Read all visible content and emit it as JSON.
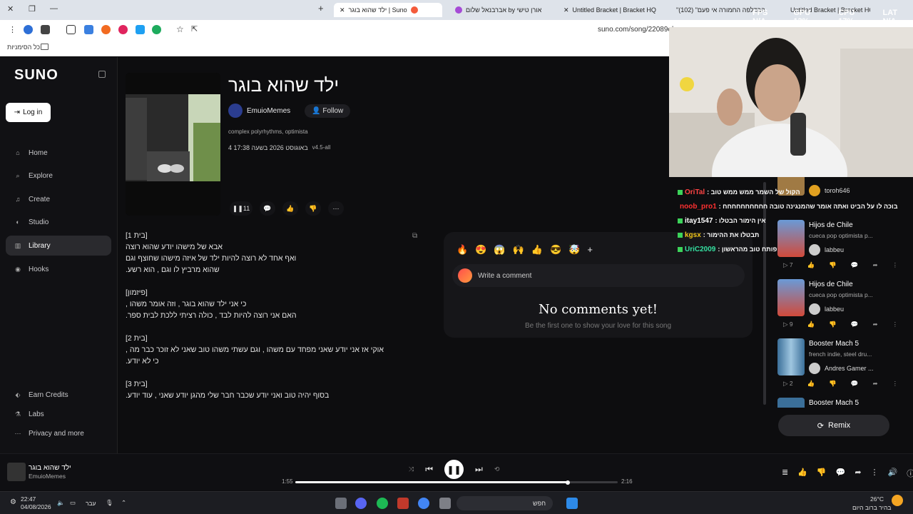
{
  "browser": {
    "tabs": [
      {
        "label": "ילד שהוא בוגר | Suno",
        "active": true,
        "color": "#f45b3b"
      },
      {
        "label": "אברבנאל שלום by אורן טישי",
        "active": false,
        "color": "#a64bd6"
      },
      {
        "label": "Untitled Bracket | Bracket HQ",
        "active": false,
        "color": "#2f55d4"
      },
      {
        "label": "\"ההדלפה החמורה אי פעם\" (102)",
        "active": false,
        "color": "#e0253a"
      },
      {
        "label": "Untitled Bracket | Bracket HQ",
        "active": false,
        "color": "#2f55d4"
      }
    ],
    "url": "suno.com/song/22089el",
    "bookmarks_label": "כל הסימניות"
  },
  "hud": {
    "fps": "FPS N/A",
    "gpu": "GPU 13%",
    "cpu": "CPU 17%",
    "lat": "LAT N/A"
  },
  "sidebar": {
    "logo": "SUNO",
    "login": "Log in",
    "nav": [
      {
        "label": "Home",
        "icon": "home-icon"
      },
      {
        "label": "Explore",
        "icon": "search-icon"
      },
      {
        "label": "Create",
        "icon": "music-icon"
      },
      {
        "label": "Studio",
        "icon": "studio-icon"
      },
      {
        "label": "Library",
        "icon": "library-icon",
        "active": true
      },
      {
        "label": "Hooks",
        "icon": "hooks-icon"
      }
    ],
    "bottom": [
      {
        "label": "Earn Credits",
        "icon": "credits-icon"
      },
      {
        "label": "Labs",
        "icon": "labs-icon"
      },
      {
        "label": "Privacy and more",
        "icon": "more-icon"
      }
    ]
  },
  "song": {
    "title": "ילד שהוא בוגר",
    "artist": "EmuioMemes",
    "follow": "Follow",
    "tags": "complex polyrhythms, optimista",
    "date": "4 באוגוסט 2026 בשעה 17:38",
    "version": "v4.5-all",
    "plays": "11"
  },
  "lyrics": [
    [
      "[בית 1]",
      "אבא של מישהו יודע שהוא רוצה",
      "ואף אחד לא רוצה להיות ילד של איזה מישהו שחוצף וגם",
      "שהוא מרביץ לו וגם , הוא רשע."
    ],
    [
      "[פיזמון]",
      "כי אני ילד שהוא בוגר , וזה אומר משהו ,",
      "האם אני רוצה להיות לבד , כולה רציתי ללכת לבית ספר."
    ],
    [
      "[בית 2]",
      "אוקי אז אני יודע שאני מפחד עם משהו , וגם עשתי משהו טוב שאני לא זוכר כבר מה ,",
      "כי לא יודע."
    ],
    [
      "[בית 3]",
      "בסוף יהיה טוב ואני יודע שכבר חבר שלי מהגן יודע שאני , עוד יודע."
    ]
  ],
  "comments": {
    "emojis": [
      "🔥",
      "😍",
      "😱",
      "🙌",
      "👍",
      "😎",
      "🤯",
      "+"
    ],
    "placeholder": "Write a comment",
    "empty_title": "No comments yet!",
    "empty_sub": "Be the first one to show your love for this song"
  },
  "chat": [
    {
      "user": "OriTal",
      "color": "#ff4444",
      "msg": ": הקול של השמר ממש ממש טוב"
    },
    {
      "user": "noob_pro1",
      "color": "#ff3030",
      "msg": ": בוכה לו על הביט ואתה אומר שהמנגינה טובה חחחחחחחחחח"
    },
    {
      "user": "itay1547",
      "color": "#ffffff",
      "msg": ": אין הימור הבטלו"
    },
    {
      "user": "kgsx",
      "color": "#f0c419",
      "msg": ": תבטלו את ההימור"
    },
    {
      "user": "UriC2009",
      "color": "#35e0a1",
      "msg": ": פותח טוב מהראשון"
    }
  ],
  "right_list": {
    "top_user": "toroh646",
    "items": [
      {
        "title": "Hijos de Chile",
        "desc": "cueca pop optimista p...",
        "user": "labbeu",
        "plays": "7"
      },
      {
        "title": "Hijos de Chile",
        "desc": "cueca pop optimista p...",
        "user": "labbeu",
        "plays": "9"
      },
      {
        "title": "Booster Mach 5",
        "desc": "french indie, steel dru...",
        "user": "Andres Gamer ...",
        "plays": "2"
      },
      {
        "title": "Booster Mach 5",
        "desc": "",
        "user": "",
        "plays": ""
      }
    ],
    "remix": "Remix"
  },
  "player": {
    "title": "ילד שהוא בוגר",
    "artist": "EmuioMemes",
    "elapsed": "1:55",
    "total": "2:16",
    "progress": 0.845
  },
  "taskbar": {
    "time": "22:47",
    "date": "04/08/2026",
    "lang": "עבר",
    "search": "חפש",
    "temp": "26°C",
    "weather": "בהיר ברוב היום"
  }
}
